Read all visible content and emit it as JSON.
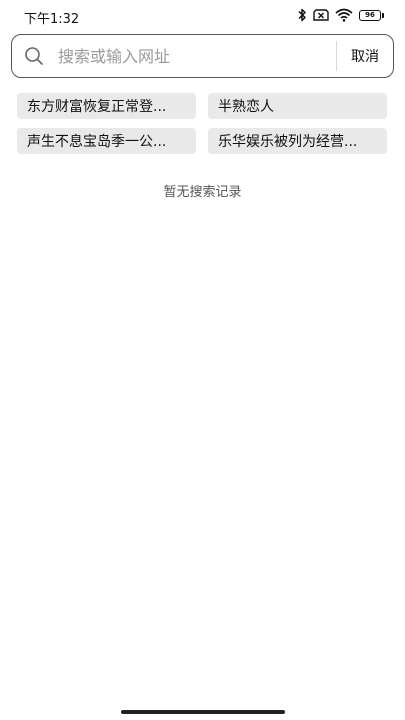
{
  "status_bar": {
    "time": "下午1:32",
    "battery": "96",
    "icons": [
      "bluetooth-icon",
      "sim-off-icon",
      "wifi-icon",
      "battery-icon"
    ]
  },
  "search": {
    "placeholder": "搜索或输入网址",
    "value": "",
    "cancel_label": "取消"
  },
  "hot_searches": [
    "东方财富恢复正常登...",
    "半熟恋人",
    "声生不息宝岛季一公...",
    "乐华娱乐被列为经营..."
  ],
  "empty_message": "暂无搜索记录",
  "colors": {
    "chip_bg": "#e9e9e9",
    "border": "#555555",
    "placeholder": "#9a9a9a"
  }
}
